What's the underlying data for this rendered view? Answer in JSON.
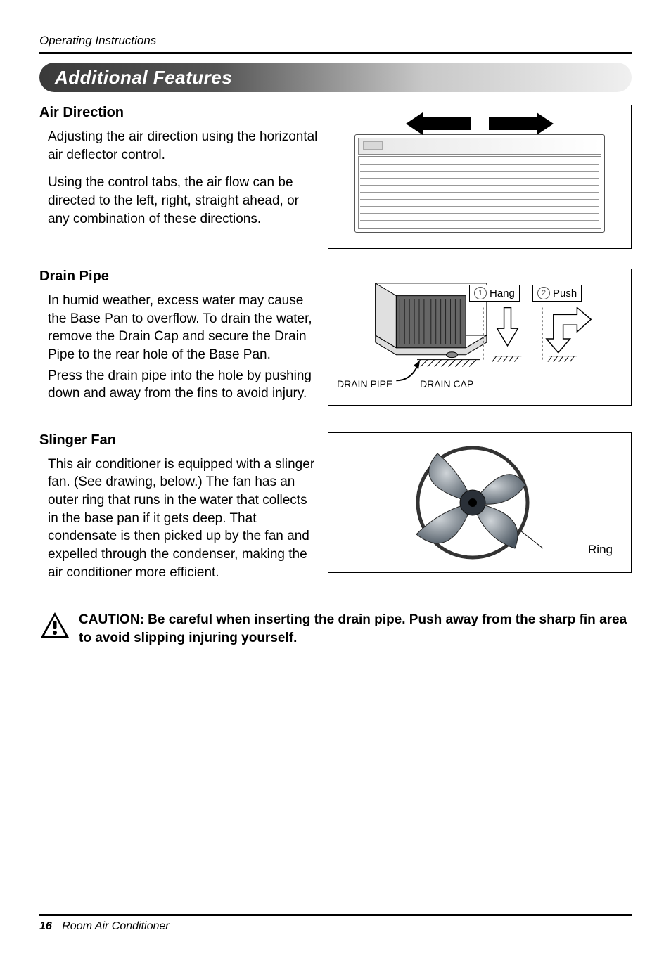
{
  "running_head": "Operating Instructions",
  "title": "Additional Features",
  "sections": {
    "air_direction": {
      "heading": "Air Direction",
      "para1": "Adjusting the air direction using the horizontal air deflector control.",
      "para2": "Using the control tabs, the air flow can be directed to the left, right, straight ahead, or any combination of these directions."
    },
    "drain_pipe": {
      "heading": "Drain Pipe",
      "para1": "In humid weather, excess water may cause the Base Pan to overflow. To drain the water, remove the Drain Cap and secure the Drain Pipe to the rear hole of the Base Pan.",
      "para2": "Press the drain pipe into the hole by pushing down and away from the fins to avoid injury.",
      "labels": {
        "drain_pipe": "DRAIN PIPE",
        "drain_cap": "DRAIN CAP",
        "hang": "Hang",
        "push": "Push",
        "num1": "1",
        "num2": "2"
      }
    },
    "slinger_fan": {
      "heading": "Slinger Fan",
      "para1": "This air conditioner is equipped with a slinger fan. (See drawing, below.) The fan has an outer ring that runs in the water that collects in the base pan if it gets deep. That condensate is then picked up by the fan and expelled through the condenser, making the air conditioner more efficient.",
      "ring_label": "Ring"
    }
  },
  "caution": {
    "prefix": "CAUTION:",
    "text": "Be careful when inserting the drain pipe. Push away from the sharp fin area to avoid slipping injuring yourself."
  },
  "footer": {
    "page_number": "16",
    "title": "Room Air Conditioner"
  }
}
